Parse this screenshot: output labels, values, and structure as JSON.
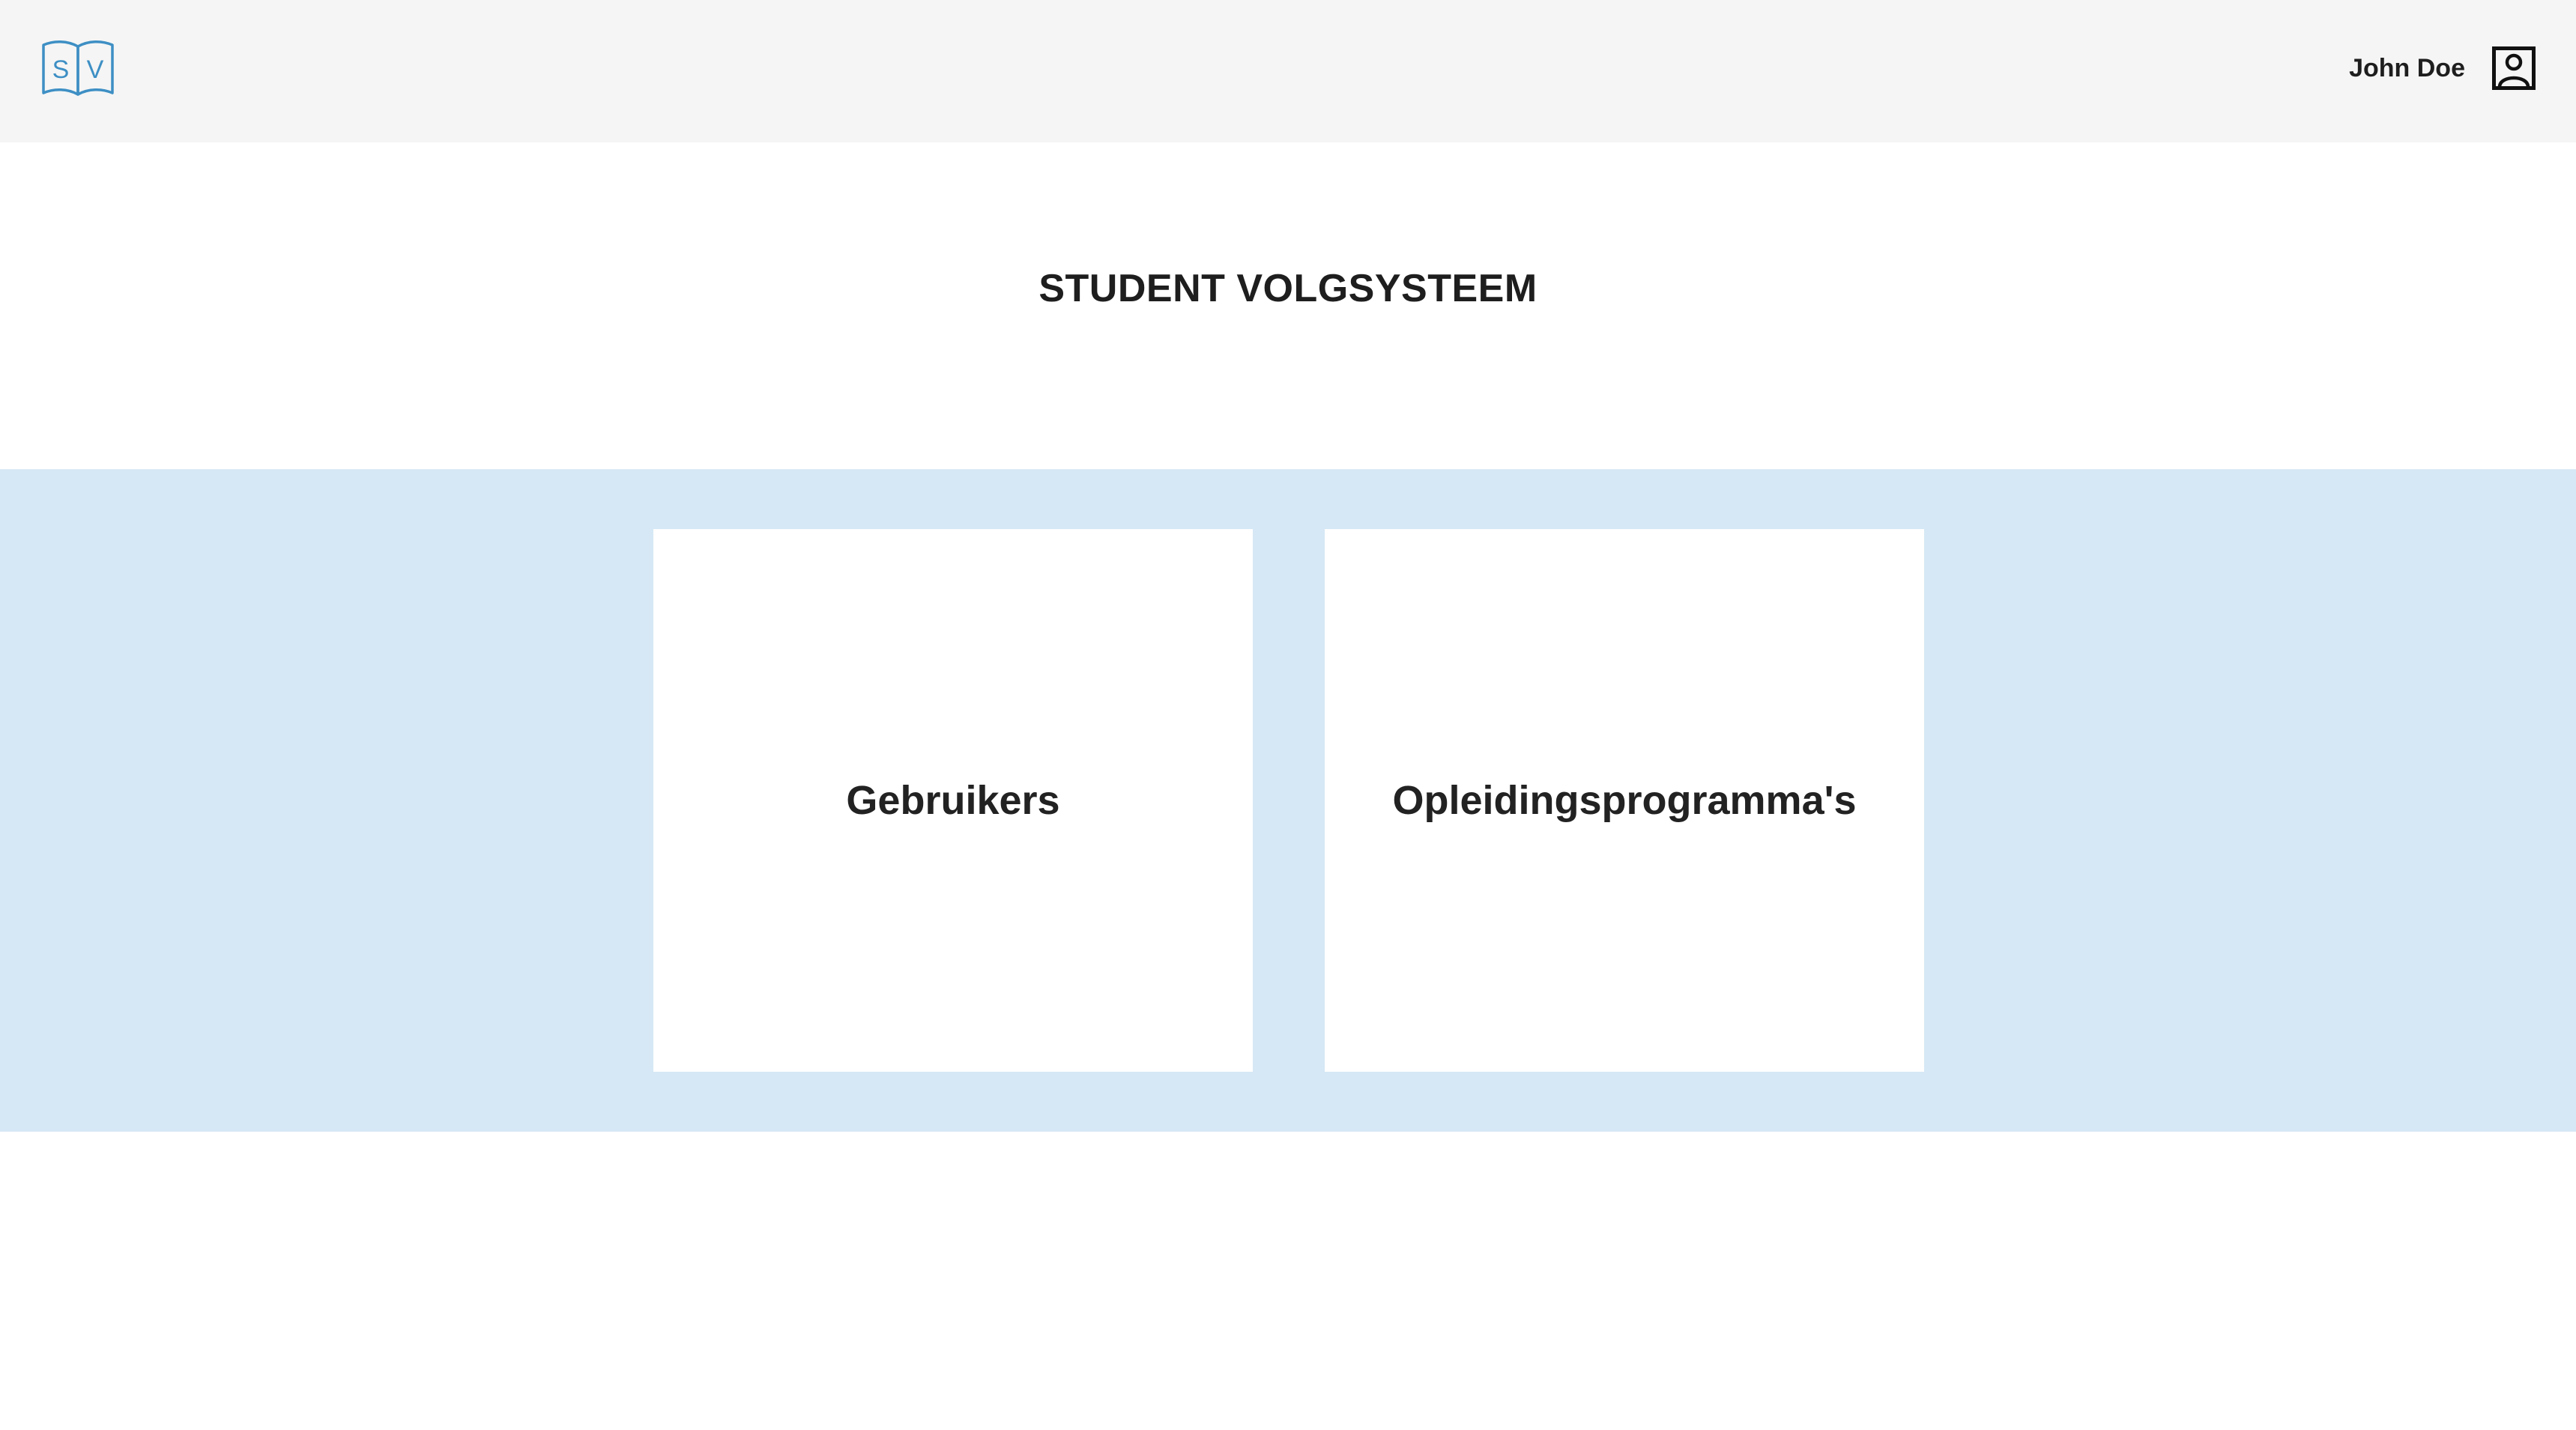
{
  "header": {
    "logo": {
      "icon": "open-book-logo-icon",
      "letters": [
        "S",
        "V"
      ],
      "color": "#3d8fc4"
    },
    "user": {
      "name": "John Doe",
      "icon": "user-account-icon"
    },
    "background": "#f5f5f5"
  },
  "main": {
    "title": "STUDENT VOLGSYSTEEM",
    "band_color": "#d6e8f5",
    "tiles": [
      {
        "label": "Gebruikers"
      },
      {
        "label": "Opleidingsprogramma's"
      }
    ]
  }
}
